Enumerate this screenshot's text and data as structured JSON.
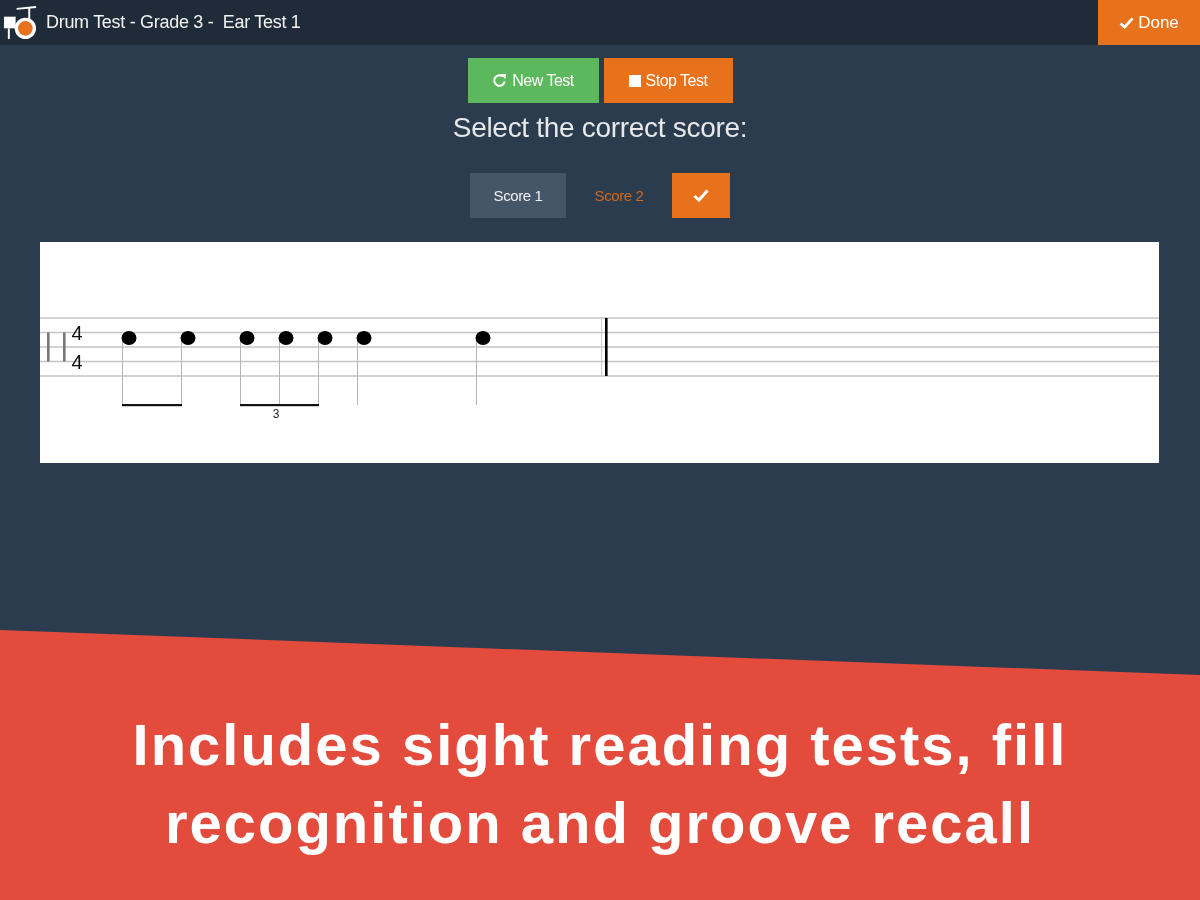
{
  "top_bar": {
    "title": "Drum Test - Grade 3 -  Ear Test 1",
    "done_button": {
      "label": "Done"
    }
  },
  "toolbar": {
    "buttons": [
      {
        "label": "New Test",
        "kind": "new"
      },
      {
        "label": "Stop Test",
        "kind": "stop"
      }
    ]
  },
  "prompt": "Select the correct score:",
  "score_choices": {
    "options": [
      {
        "label": "Score 1",
        "selected": true
      },
      {
        "label": "Score 2",
        "selected": false
      }
    ]
  },
  "notation": {
    "time_signature": {
      "numerator": "4",
      "denominator": "4"
    },
    "tuplet_label": "3"
  },
  "banner": {
    "caption": "Includes sight reading tests, fill recognition and groove recall"
  }
}
